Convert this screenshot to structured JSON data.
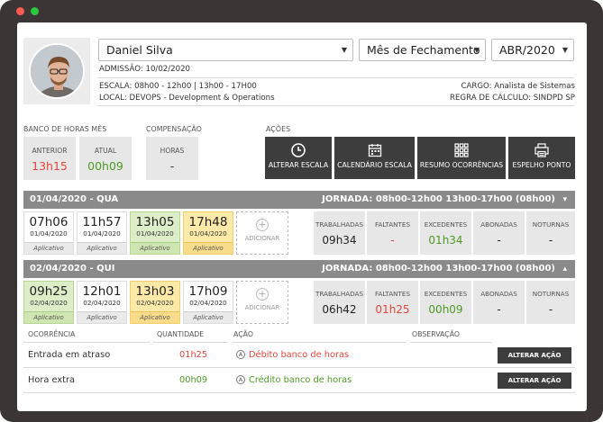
{
  "window": {
    "dots": [
      "#ff5b52",
      "#2bc840"
    ]
  },
  "employee": {
    "name": "Daniel Silva",
    "admission": "ADMISSÃO: 10/02/2020",
    "schedule": "ESCALA: 08h00 - 12h00 | 13h00 - 17H00",
    "location": "LOCAL: DEVOPS - Development & Operations",
    "role": "CARGO: Analista de Sistemas",
    "calc_rule": "REGRA DE CÁLCULO: SINDPD SP"
  },
  "filters": {
    "period_type": "Mês de Fechamento",
    "month": "ABR/2020"
  },
  "hour_bank": {
    "title": "BANCO DE HORAS MÊS",
    "previous_label": "ANTERIOR",
    "previous_value": "13h15",
    "current_label": "ATUAL",
    "current_value": "00h09"
  },
  "compensation": {
    "title": "COMPENSAÇÃO",
    "hours_label": "HORAS",
    "hours_value": "-"
  },
  "actions": {
    "title": "AÇÕES",
    "buttons": [
      {
        "label": "ALTERAR ESCALA",
        "icon": "clock-icon"
      },
      {
        "label": "CALENDÁRIO ESCALA",
        "icon": "calendar-icon"
      },
      {
        "label": "RESUMO OCORRÊNCIAS",
        "icon": "grid-icon"
      },
      {
        "label": "ESPELHO PONTO",
        "icon": "printer-icon"
      }
    ]
  },
  "days": [
    {
      "date": "01/04/2020 - QUA",
      "journey": "JORNADA: 08h00-12h00 13h00-17h00 (08h00)",
      "chevron": "▾",
      "punches": [
        {
          "time": "07h06",
          "date": "01/04/2020",
          "source": "Aplicativo",
          "status": "normal"
        },
        {
          "time": "11h57",
          "date": "01/04/2020",
          "source": "Aplicativo",
          "status": "normal"
        },
        {
          "time": "13h05",
          "date": "01/04/2020",
          "source": "Aplicativo",
          "status": "green"
        },
        {
          "time": "17h48",
          "date": "01/04/2020",
          "source": "Aplicativo",
          "status": "yellow"
        }
      ],
      "add_label": "ADICIONAR",
      "stats": [
        {
          "label": "TRABALHADAS",
          "value": "09h34",
          "color": "#222222"
        },
        {
          "label": "FALTANTES",
          "value": "-",
          "color": "#e0463c"
        },
        {
          "label": "EXCEDENTES",
          "value": "01h34",
          "color": "#4e9a24"
        },
        {
          "label": "ABONADAS",
          "value": "-",
          "color": "#222222"
        },
        {
          "label": "NOTURNAS",
          "value": "-",
          "color": "#222222"
        }
      ]
    },
    {
      "date": "02/04/2020 - QUI",
      "journey": "JORNADA: 08h00-12h00 13h00-17h00 (08h00)",
      "chevron": "▴",
      "punches": [
        {
          "time": "09h25",
          "date": "02/04/2020",
          "source": "Aplicativo",
          "status": "green"
        },
        {
          "time": "12h01",
          "date": "02/04/2020",
          "source": "Aplicativo",
          "status": "normal"
        },
        {
          "time": "13h03",
          "date": "02/04/2020",
          "source": "Aplicativo",
          "status": "yellow"
        },
        {
          "time": "17h09",
          "date": "02/04/2020",
          "source": "Aplicativo",
          "status": "normal"
        }
      ],
      "add_label": "ADICIONAR",
      "stats": [
        {
          "label": "TRABALHADAS",
          "value": "06h42",
          "color": "#222222"
        },
        {
          "label": "FALTANTES",
          "value": "01h25",
          "color": "#e0463c"
        },
        {
          "label": "EXCEDENTES",
          "value": "00h09",
          "color": "#4e9a24"
        },
        {
          "label": "ABONADAS",
          "value": "-",
          "color": "#222222"
        },
        {
          "label": "NOTURNAS",
          "value": "-",
          "color": "#222222"
        }
      ]
    }
  ],
  "occurrences": {
    "headers": {
      "occurrence": "OCORRÊNCIA",
      "quantity": "QUANTIDADE",
      "action": "AÇÃO",
      "observation": "OBSERVAÇÃO"
    },
    "rows": [
      {
        "occurrence": "Entrada em atraso",
        "quantity": "01h25",
        "qty_color": "#e0463c",
        "action": "Débito banco de horas",
        "action_color": "#e0463c",
        "button": "ALTERAR AÇÃO",
        "badge": "A"
      },
      {
        "occurrence": "Hora extra",
        "quantity": "00h09",
        "qty_color": "#4e9a24",
        "action": "Crédito banco de horas",
        "action_color": "#4e9a24",
        "button": "ALTERAR AÇÃO",
        "badge": "A"
      }
    ]
  }
}
